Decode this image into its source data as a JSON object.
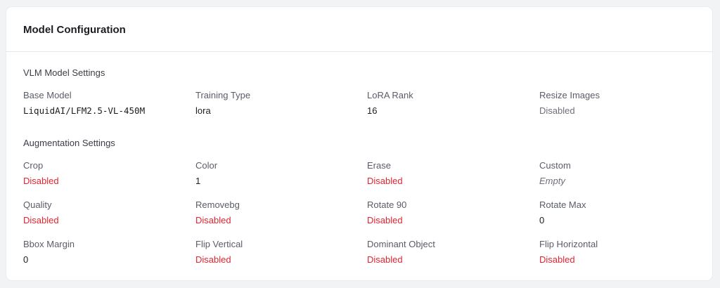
{
  "card": {
    "title": "Model Configuration"
  },
  "vlm": {
    "section_title": "VLM Model Settings",
    "base_model": {
      "label": "Base Model",
      "value": "LiquidAI/LFM2.5-VL-450M"
    },
    "training_type": {
      "label": "Training Type",
      "value": "lora"
    },
    "lora_rank": {
      "label": "LoRA Rank",
      "value": "16"
    },
    "resize_images": {
      "label": "Resize Images",
      "value": "Disabled"
    }
  },
  "augmentation": {
    "section_title": "Augmentation Settings",
    "crop": {
      "label": "Crop",
      "value": "Disabled"
    },
    "color": {
      "label": "Color",
      "value": "1"
    },
    "erase": {
      "label": "Erase",
      "value": "Disabled"
    },
    "custom": {
      "label": "Custom",
      "value": "Empty"
    },
    "quality": {
      "label": "Quality",
      "value": "Disabled"
    },
    "removebg": {
      "label": "Removebg",
      "value": "Disabled"
    },
    "rotate_90": {
      "label": "Rotate 90",
      "value": "Disabled"
    },
    "rotate_max": {
      "label": "Rotate Max",
      "value": "0"
    },
    "bbox_margin": {
      "label": "Bbox Margin",
      "value": "0"
    },
    "flip_vertical": {
      "label": "Flip Vertical",
      "value": "Disabled"
    },
    "dominant_object": {
      "label": "Dominant Object",
      "value": "Disabled"
    },
    "flip_horizontal": {
      "label": "Flip Horizontal",
      "value": "Disabled"
    }
  },
  "colors": {
    "disabled_status": "#e5232f",
    "card_background": "#ffffff",
    "page_background": "#f2f3f5"
  }
}
